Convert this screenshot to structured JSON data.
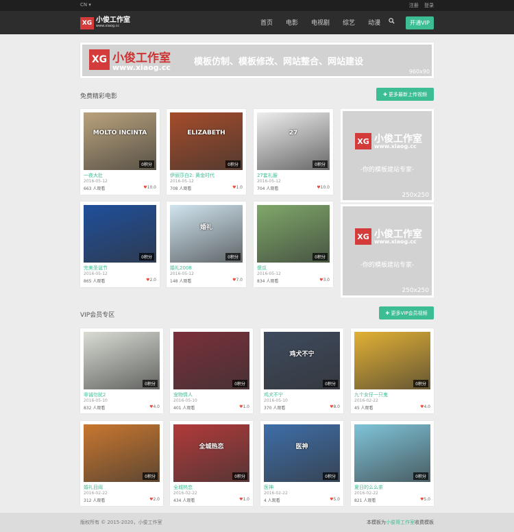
{
  "topbar": {
    "lang": "CN ▾",
    "register": "注册",
    "login": "登录"
  },
  "navbar": {
    "logo_mark": "XG",
    "logo_title": "小俊工作室",
    "logo_url": "www.xiaog.cc",
    "links": [
      "首页",
      "电影",
      "电视剧",
      "综艺",
      "动漫"
    ],
    "search_icon": "search-icon",
    "vip_button": "开通VIP"
  },
  "banner": {
    "mark": "XG",
    "title": "小俊工作室",
    "url": "www.xiaog.cc",
    "slogan": "模板仿制、模板修改、网站整合、网站建设",
    "size": "960x90"
  },
  "ad": {
    "mark": "XG",
    "title": "小俊工作室",
    "url": "www.xiaog.cc",
    "slogan": "-你的模板建站专家-",
    "size": "250x250"
  },
  "section_free": {
    "title": "免费精彩电影",
    "button": "✚ 更多最新上传视频",
    "cards": [
      {
        "title": "一夜大肚",
        "date": "2016-05-12",
        "views": "663 人观看",
        "rating": "10.0",
        "points": "0积分",
        "poster_text": "MOLTO INCINTA",
        "poster_bg": "#b9a27c"
      },
      {
        "title": "伊丽莎白2: 黄金时代",
        "date": "2016-05-12",
        "views": "708 人观看",
        "rating": "1.0",
        "points": "0积分",
        "poster_text": "ELIZABETH",
        "poster_bg": "#a54c2a"
      },
      {
        "title": "27套礼服",
        "date": "2016-05-12",
        "views": "704 人观看",
        "rating": "10.0",
        "points": "0积分",
        "poster_text": "27",
        "poster_bg": "#eeeeee"
      },
      {
        "title": "完美圣诞节",
        "date": "2016-05-12",
        "views": "865 人观看",
        "rating": "2.0",
        "points": "0积分",
        "poster_text": "",
        "poster_bg": "#1f4f9c"
      },
      {
        "title": "婚礼2008",
        "date": "2016-05-12",
        "views": "148 人观看",
        "rating": "7.0",
        "points": "0积分",
        "poster_text": "婚礼",
        "poster_bg": "#d0e4ef"
      },
      {
        "title": "傻瓜",
        "date": "2016-05-12",
        "views": "834 人观看",
        "rating": "3.0",
        "points": "0积分",
        "poster_text": "",
        "poster_bg": "#7fa86a"
      }
    ]
  },
  "section_vip": {
    "title": "VIP会员专区",
    "button": "✚ 更多VIP会员视频",
    "cards": [
      {
        "title": "非诚勿扰2",
        "date": "2016-05-10",
        "views": "832 人观看",
        "rating": "4.0",
        "points": "0积分",
        "poster_text": "",
        "poster_bg": "#d8dcd3"
      },
      {
        "title": "宠物情人",
        "date": "2016-05-10",
        "views": "401 人观看",
        "rating": "1.0",
        "points": "0积分",
        "poster_text": "",
        "poster_bg": "#7b2f3a"
      },
      {
        "title": "鸡犬不宁",
        "date": "2016-05-10",
        "views": "370 人观看",
        "rating": "8.0",
        "points": "0积分",
        "poster_text": "鸡犬不宁",
        "poster_bg": "#3d4a5e"
      },
      {
        "title": "九个女仔一只鬼",
        "date": "2016-02-22",
        "views": "45 人观看",
        "rating": "4.0",
        "points": "0积分",
        "poster_text": "",
        "poster_bg": "#e2b035"
      },
      {
        "title": "婚礼目阈",
        "date": "2016-02-22",
        "views": "312 人观看",
        "rating": "2.0",
        "points": "0积分",
        "poster_text": "",
        "poster_bg": "#c9772f"
      },
      {
        "title": "全城热恋",
        "date": "2016-02-22",
        "views": "434 人观看",
        "rating": "1.0",
        "points": "0积分",
        "poster_text": "全城热恋",
        "poster_bg": "#b23a3a"
      },
      {
        "title": "医神",
        "date": "2016-02-22",
        "views": "4 人观看",
        "rating": "5.0",
        "points": "0积分",
        "poster_text": "医神",
        "poster_bg": "#3e6ea8"
      },
      {
        "title": "夏日的么么茶",
        "date": "2016-02-22",
        "views": "821 人观看",
        "rating": "5.0",
        "points": "0积分",
        "poster_text": "",
        "poster_bg": "#7fc4d9"
      }
    ]
  },
  "footer": {
    "copyright": "版权所有 © 2015-2020，小俊工作室",
    "credit_prefix": "本模板为",
    "credit_link": "小俊哥工作室",
    "credit_suffix": "收费模板"
  }
}
